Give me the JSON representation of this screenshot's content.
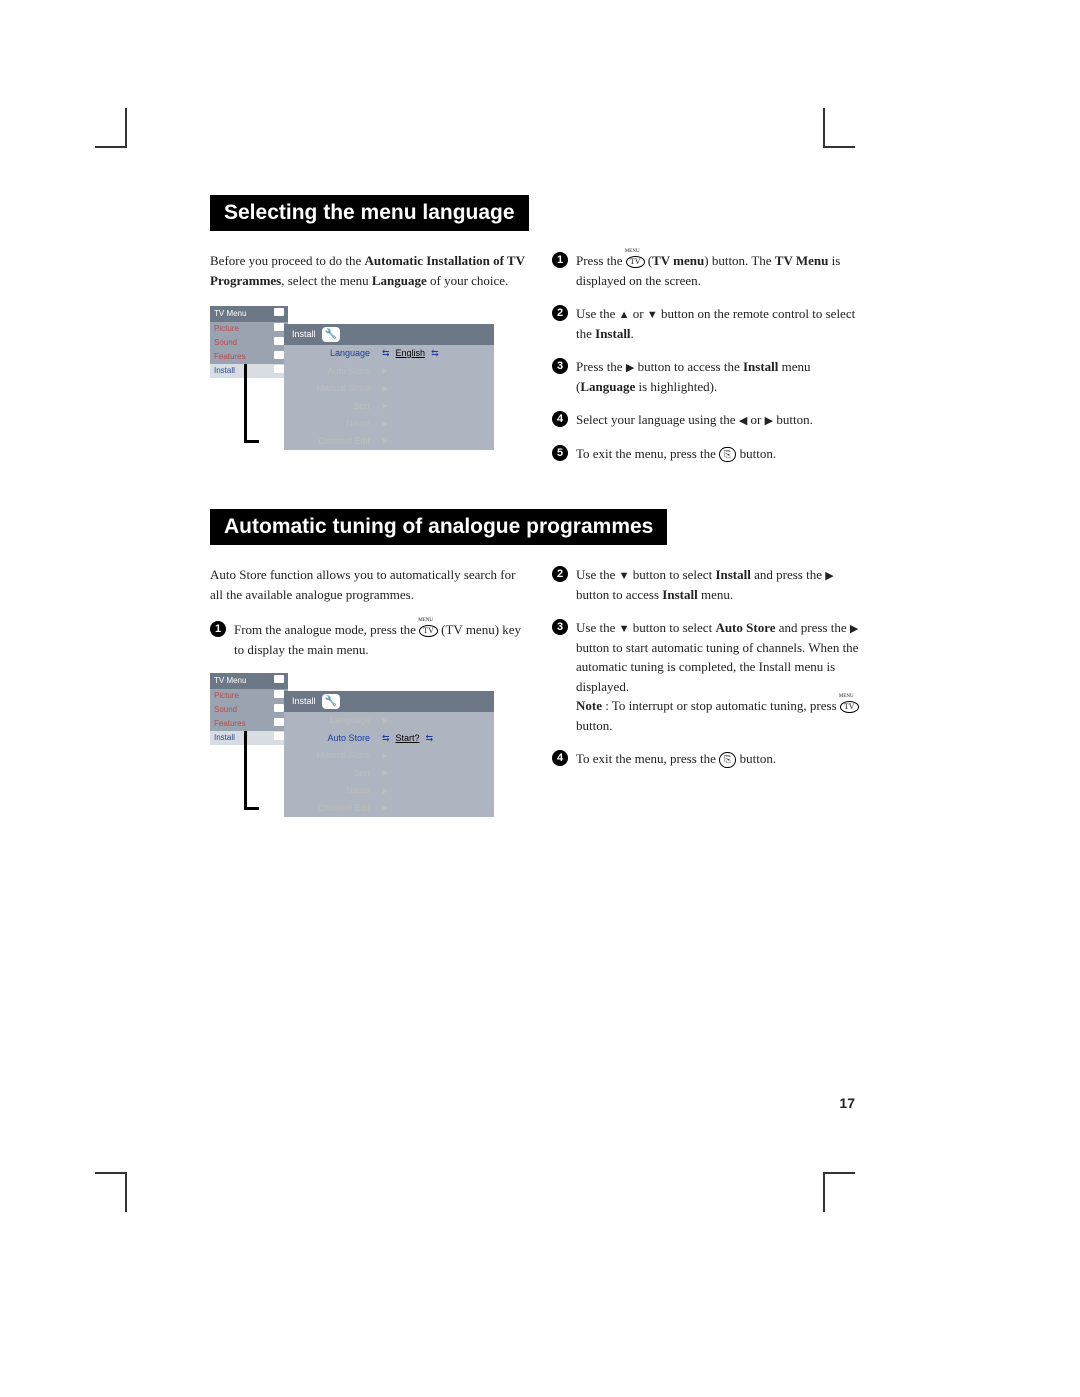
{
  "page_number": "17",
  "section1": {
    "title": "Selecting the menu language",
    "intro_a": "Before you proceed to do the ",
    "intro_b": "Automatic Installation of TV Programmes",
    "intro_c": ", select the menu ",
    "intro_d": "Language",
    "intro_e": " of your choice.",
    "steps": {
      "s1a": "Press the ",
      "s1b": " (",
      "s1c": "TV menu",
      "s1d": ") button. The ",
      "s1e": "TV Menu",
      "s1f": " is displayed on the screen.",
      "s2a": "Use the ",
      "s2b": " or ",
      "s2c": " button on the remote control to select the ",
      "s2d": "Install",
      "s2e": ".",
      "s3a": "Press the ",
      "s3b": " button to access the ",
      "s3c": "Install",
      "s3d": " menu (",
      "s3e": "Language",
      "s3f": " is highlighted).",
      "s4a": "Select your language using the ",
      "s4b": " or ",
      "s4c": " button.",
      "s5a": "To exit the menu, press the ",
      "s5b": " button."
    },
    "osd": {
      "main_title": "TV Menu",
      "items": [
        "Picture",
        "Sound",
        "Features",
        "Install"
      ],
      "sub_title": "Install",
      "rows": [
        {
          "label": "Language",
          "value": "English",
          "sel": true
        },
        {
          "label": "Auto Store"
        },
        {
          "label": "Manual Store"
        },
        {
          "label": "Sort"
        },
        {
          "label": "Name"
        },
        {
          "label": "Channel Edit"
        }
      ]
    }
  },
  "section2": {
    "title": "Automatic tuning of analogue programmes",
    "intro": "Auto Store function allows you to automatically search for all the available analogue programmes.",
    "left_step1a": "From the analogue mode, press the ",
    "left_step1b": " (TV menu) key to display the main menu.",
    "steps": {
      "s2a": "Use the ",
      "s2b": " button to select ",
      "s2c": "Install",
      "s2d": " and press the ",
      "s2e": " button to access ",
      "s2f": "Install",
      "s2g": "  menu.",
      "s3a": "Use the ",
      "s3b": " button to select ",
      "s3c": "Auto Store",
      "s3d": " and press the ",
      "s3e": " button to start automatic tuning of channels.  When the automatic tuning is completed, the Install menu is displayed.",
      "s3note_a": "Note",
      "s3note_b": " : To interrupt or stop automatic tuning, press ",
      "s3note_c": " button.",
      "s4a": "To exit the menu, press the ",
      "s4b": " button."
    },
    "osd": {
      "main_title": "TV Menu",
      "items": [
        "Picture",
        "Sound",
        "Features",
        "Install"
      ],
      "sub_title": "Install",
      "rows": [
        {
          "label": "Language"
        },
        {
          "label": "Auto Store",
          "value": "Start?",
          "sel": true
        },
        {
          "label": "Manual Store"
        },
        {
          "label": "Sort"
        },
        {
          "label": "Name"
        },
        {
          "label": "Channel Edit"
        }
      ]
    }
  },
  "glyphs": {
    "tv": "TV",
    "up": "▲",
    "down": "▼",
    "left": "◀",
    "right": "▶",
    "exit": "⎘",
    "lr_small": "⇆"
  }
}
